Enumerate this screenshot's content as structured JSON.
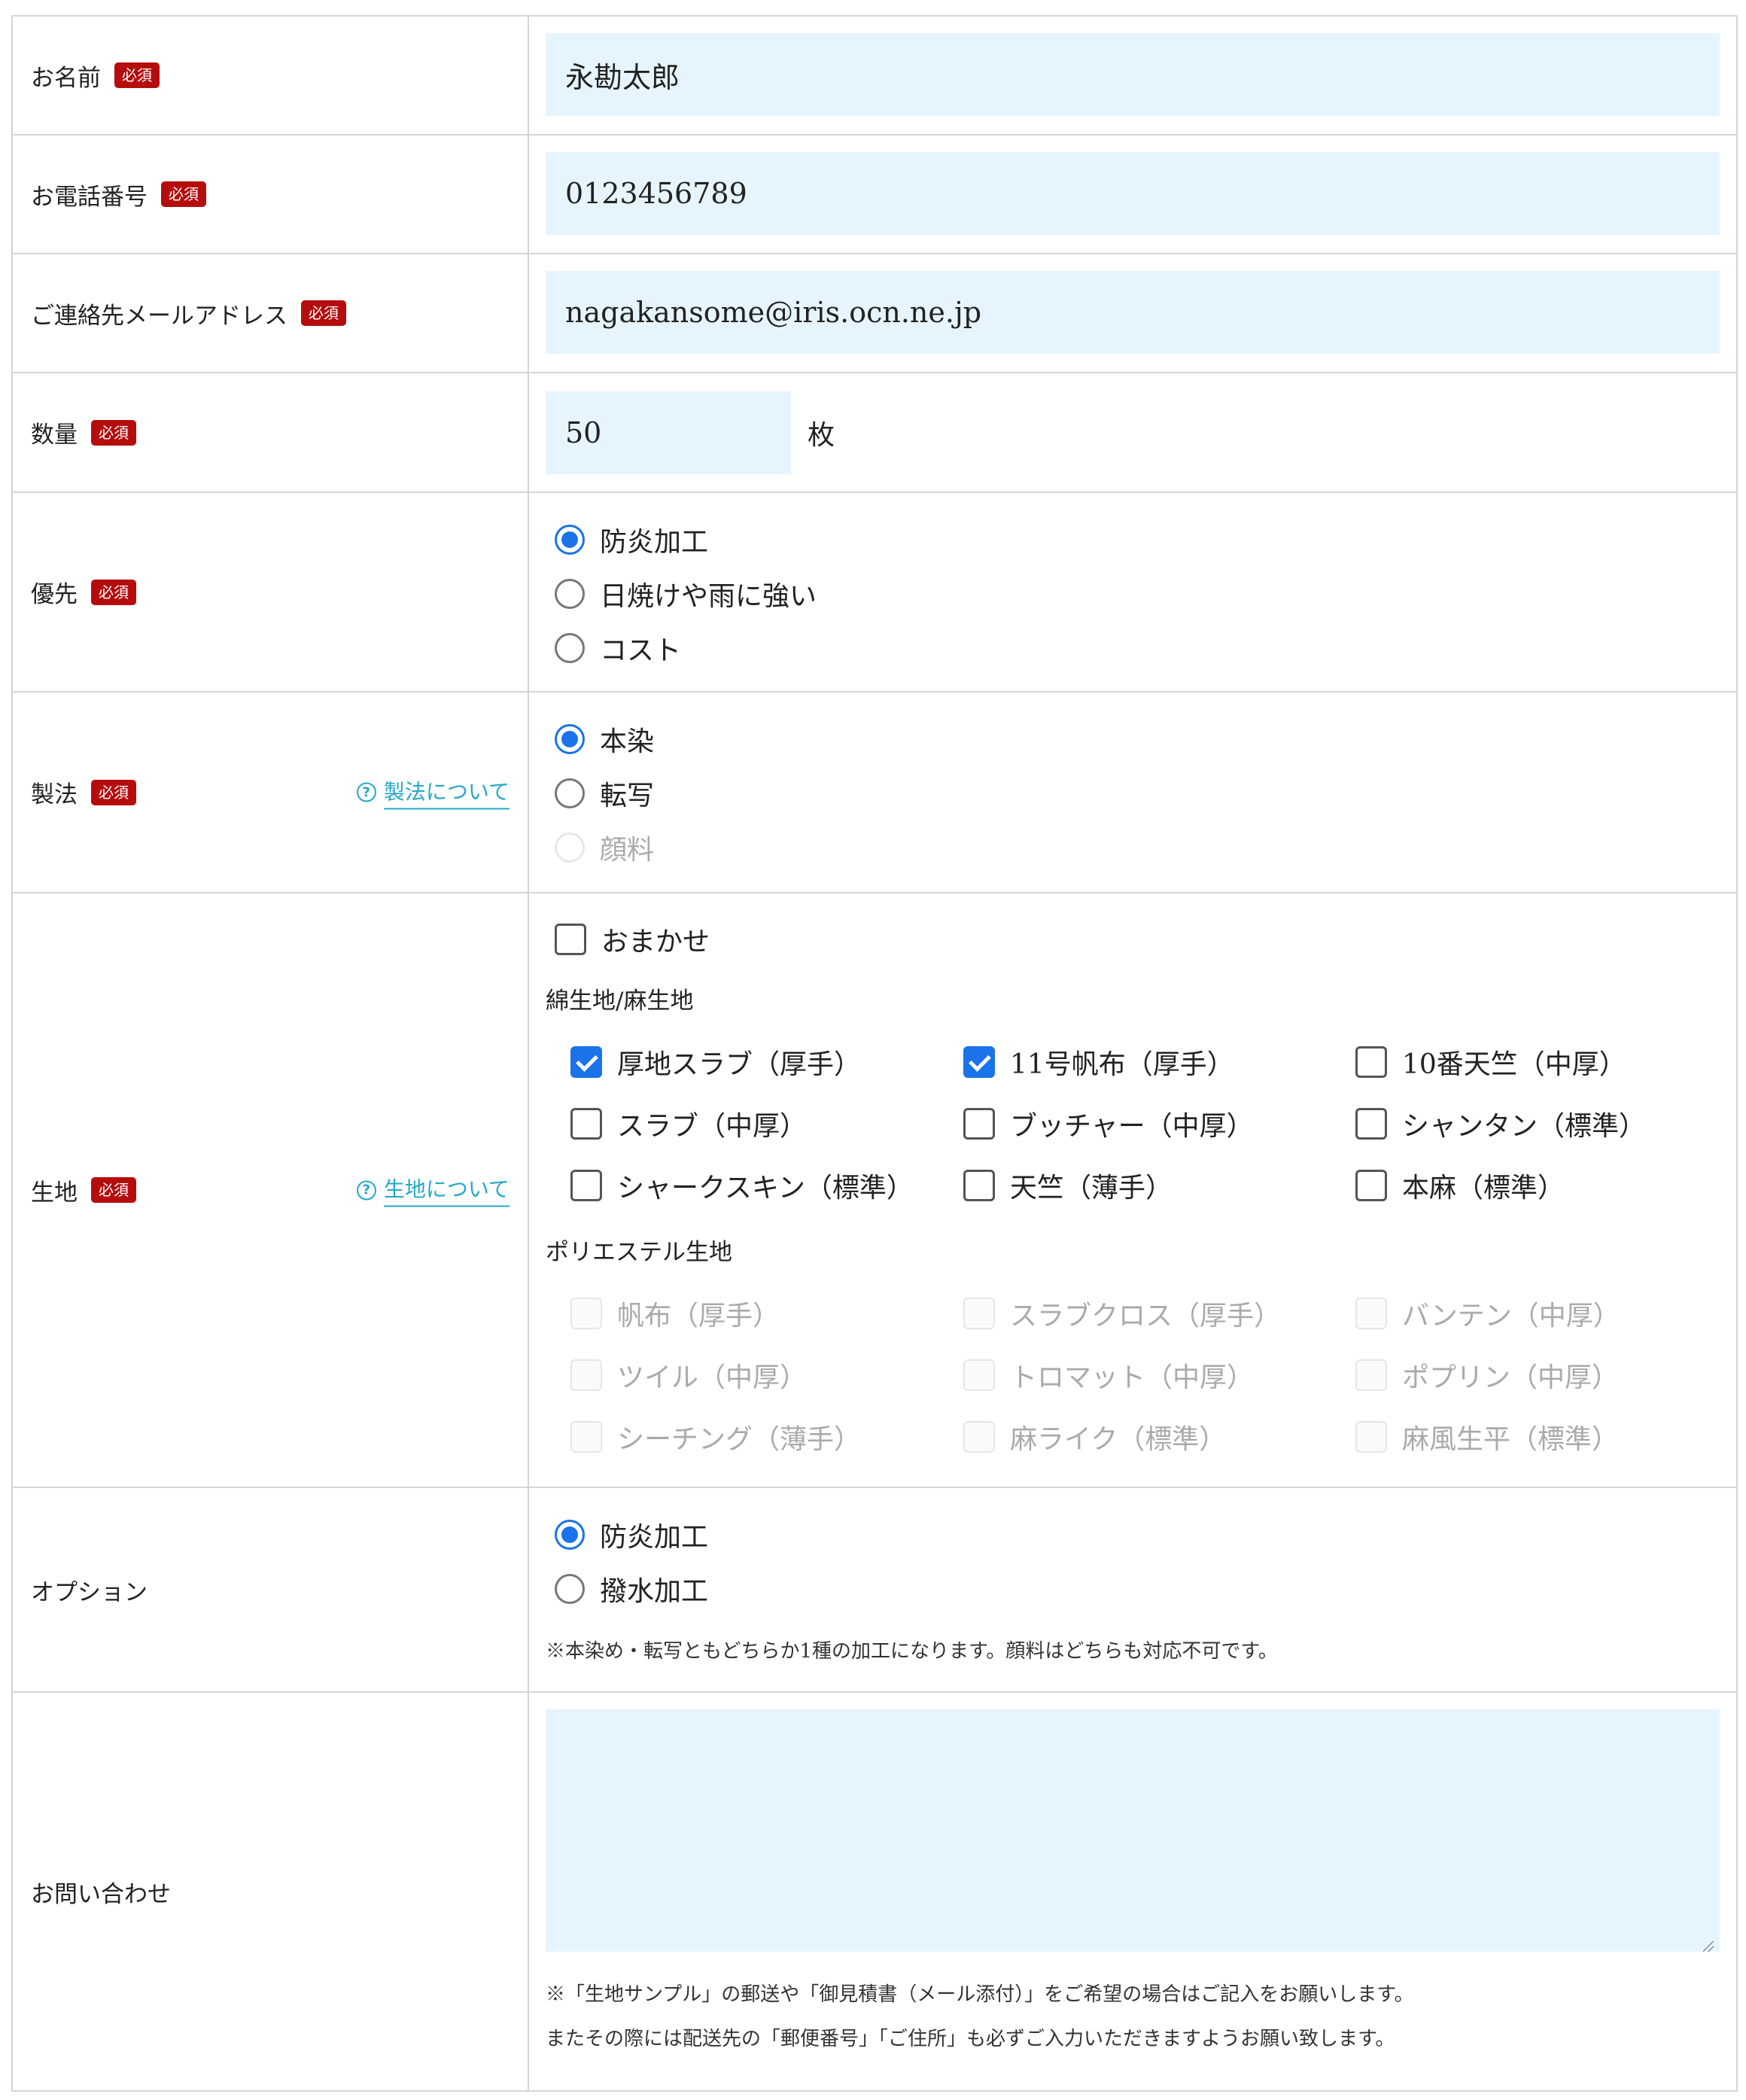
{
  "required_badge": "必須",
  "fields": {
    "name": {
      "label": "お名前",
      "value": "永勘太郎"
    },
    "phone": {
      "label": "お電話番号",
      "value": "0123456789"
    },
    "email": {
      "label": "ご連絡先メールアドレス",
      "value": "nagakansome@iris.ocn.ne.jp"
    },
    "quantity": {
      "label": "数量",
      "value": "50",
      "unit": "枚"
    },
    "priority": {
      "label": "優先",
      "options": [
        {
          "label": "防炎加工",
          "checked": true
        },
        {
          "label": "日焼けや雨に強い",
          "checked": false
        },
        {
          "label": "コスト",
          "checked": false
        }
      ]
    },
    "method": {
      "label": "製法",
      "help_text": "製法について",
      "options": [
        {
          "label": "本染",
          "checked": true
        },
        {
          "label": "転写",
          "checked": false
        },
        {
          "label": "顔料",
          "checked": false,
          "disabled": true
        }
      ]
    },
    "fabric": {
      "label": "生地",
      "help_text": "生地について",
      "auto_label": "おまかせ",
      "cotton_title": "綿生地/麻生地",
      "cotton": [
        {
          "label": "厚地スラブ（厚手）",
          "checked": true
        },
        {
          "label": "11号帆布（厚手）",
          "checked": true
        },
        {
          "label": "10番天竺（中厚）",
          "checked": false
        },
        {
          "label": "スラブ（中厚）",
          "checked": false
        },
        {
          "label": "ブッチャー（中厚）",
          "checked": false
        },
        {
          "label": "シャンタン（標準）",
          "checked": false
        },
        {
          "label": "シャークスキン（標準）",
          "checked": false
        },
        {
          "label": "天竺（薄手）",
          "checked": false
        },
        {
          "label": "本麻（標準）",
          "checked": false
        }
      ],
      "poly_title": "ポリエステル生地",
      "poly": [
        {
          "label": "帆布（厚手）"
        },
        {
          "label": "スラブクロス（厚手）"
        },
        {
          "label": "バンテン（中厚）"
        },
        {
          "label": "ツイル（中厚）"
        },
        {
          "label": "トロマット（中厚）"
        },
        {
          "label": "ポプリン（中厚）"
        },
        {
          "label": "シーチング（薄手）"
        },
        {
          "label": "麻ライク（標準）"
        },
        {
          "label": "麻風生平（標準）"
        }
      ]
    },
    "option": {
      "label": "オプション",
      "options": [
        {
          "label": "防炎加工",
          "checked": true
        },
        {
          "label": "撥水加工",
          "checked": false
        }
      ],
      "note": "※本染め・転写ともどちらか1種の加工になります。顔料はどちらも対応不可です。"
    },
    "inquiry": {
      "label": "お問い合わせ",
      "value": "",
      "note1": "※「生地サンプル」の郵送や「御見積書（メール添付）」をご希望の場合はご記入をお願いします。",
      "note2": "またその際には配送先の「郵便番号」「ご住所」も必ずご入力いただきますようお願い致します。"
    }
  }
}
